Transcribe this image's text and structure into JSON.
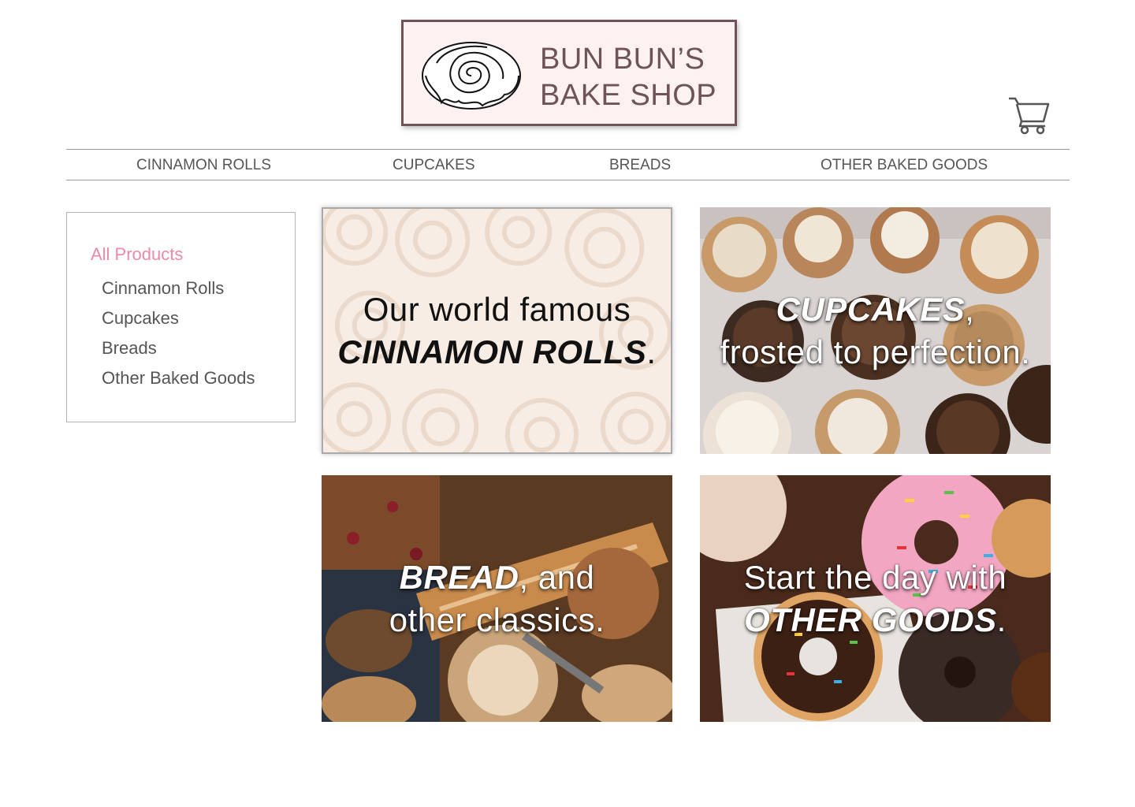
{
  "brand": {
    "line1": "BUN BUN’S",
    "line2": "BAKE SHOP",
    "logo_icon": "cinnamon-roll-icon",
    "color": "#6e5458",
    "background": "#fdf1f2"
  },
  "header": {
    "cart_icon": "shopping-cart-icon"
  },
  "nav": {
    "items": [
      {
        "label": "CINNAMON ROLLS"
      },
      {
        "label": "CUPCAKES"
      },
      {
        "label": "BREADS"
      },
      {
        "label": "OTHER BAKED GOODS"
      }
    ]
  },
  "sidebar": {
    "heading": "All Products",
    "heading_color": "#ea8aa6",
    "items": [
      {
        "label": "Cinnamon Rolls"
      },
      {
        "label": "Cupcakes"
      },
      {
        "label": "Breads"
      },
      {
        "label": "Other Baked Goods"
      }
    ]
  },
  "tiles": [
    {
      "line1_pre": "Our world famous",
      "line2_bold": "CINNAMON ROLLS",
      "line2_post": "."
    },
    {
      "line1_bold": "CUPCAKES",
      "line1_post": ",",
      "line2": "frosted to perfection."
    },
    {
      "line1_bold": "BREAD",
      "line1_post": ", and",
      "line2": "other classics."
    },
    {
      "line1": "Start the day with",
      "line2_bold": "OTHER GOODS",
      "line2_post": "."
    }
  ]
}
